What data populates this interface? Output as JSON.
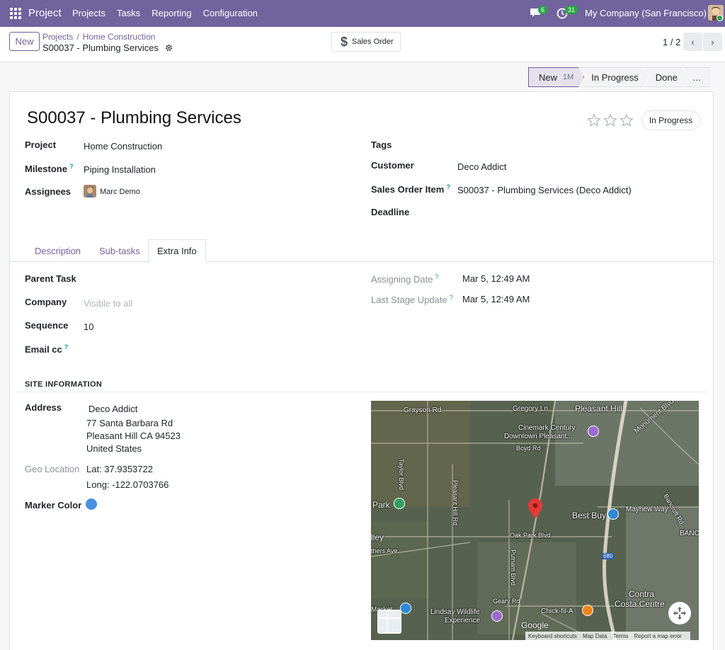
{
  "navbar": {
    "app_name": "Project",
    "menu": [
      "Projects",
      "Tasks",
      "Reporting",
      "Configuration"
    ],
    "chat_count": "6",
    "activity_count": "31",
    "company": "My Company (San Francisco)"
  },
  "control": {
    "new_label": "New",
    "breadcrumb": [
      "Projects",
      "Home Construction"
    ],
    "record_title": "S00037 - Plumbing Services",
    "smart_button": "Sales Order",
    "pager": "1 / 2"
  },
  "statusbar": {
    "stages": [
      "New",
      "In Progress",
      "Done",
      "..."
    ],
    "current_tag": "1M"
  },
  "form": {
    "name": "S00037 - Plumbing Services",
    "state": "In Progress",
    "left_fields": [
      {
        "label": "Project",
        "value": "Home Construction"
      },
      {
        "label": "Milestone",
        "help": "?",
        "value": "Piping Installation"
      },
      {
        "label": "Assignees",
        "value": "Marc Demo"
      }
    ],
    "right_fields": [
      {
        "label": "Tags",
        "value": ""
      },
      {
        "label": "Customer",
        "value": "Deco Addict"
      },
      {
        "label": "Sales Order Item",
        "help": "?",
        "value": "S00037 - Plumbing Services (Deco Addict)"
      },
      {
        "label": "Deadline",
        "value": ""
      }
    ]
  },
  "tabs": [
    "Description",
    "Sub-tasks",
    "Extra Info"
  ],
  "extra_info": {
    "left": [
      {
        "label": "Parent Task",
        "value": ""
      },
      {
        "label": "Company",
        "value": "",
        "placeholder": "Visible to all"
      },
      {
        "label": "Sequence",
        "value": "10"
      },
      {
        "label": "Email cc",
        "help": "?",
        "value": ""
      }
    ],
    "right": [
      {
        "label": "Assigning Date",
        "help": "?",
        "value": "Mar 5, 12:49 AM"
      },
      {
        "label": "Last Stage Update",
        "help": "?",
        "value": "Mar 5, 12:49 AM"
      }
    ]
  },
  "site": {
    "title": "SITE INFORMATION",
    "address_label": "Address",
    "address_lines": [
      "Deco Addict",
      "77 Santa Barbara Rd",
      "Pleasant Hill CA 94523",
      "United States"
    ],
    "geo_label": "Geo Location",
    "lat": "Lat: 37.9353722",
    "long": "Long: -122.0703766",
    "marker_label": "Marker Color",
    "marker_color": "#4a90e2"
  },
  "map": {
    "labels": [
      "Pleasant Hill",
      "Grayson Rd",
      "Gregory Ln",
      "Monument Blvd",
      "Cinemark Century",
      "Downtown Pleasant...",
      "Boyd Rd",
      "Taylor Blvd",
      "Pleasant Hill Rd",
      "Park",
      "Best Buy",
      "Mayhew Way",
      "Bancroft Rd",
      "BANC",
      "lley",
      "Oak Park Blvd",
      "thers Ave",
      "680",
      "Putnam Blvd",
      "Geary Rd",
      "Contra",
      "Costa Centre",
      "Lindsay Wildlife",
      "Experience",
      "Chick-fil-A",
      "Market"
    ],
    "footer": [
      "Keyboard shortcuts",
      "Map Data",
      "Terms",
      "Report a map error"
    ],
    "google": "Google"
  },
  "colors": {
    "brand": "#71639e",
    "marker": "#4a90e2",
    "badge": "#28a745"
  }
}
